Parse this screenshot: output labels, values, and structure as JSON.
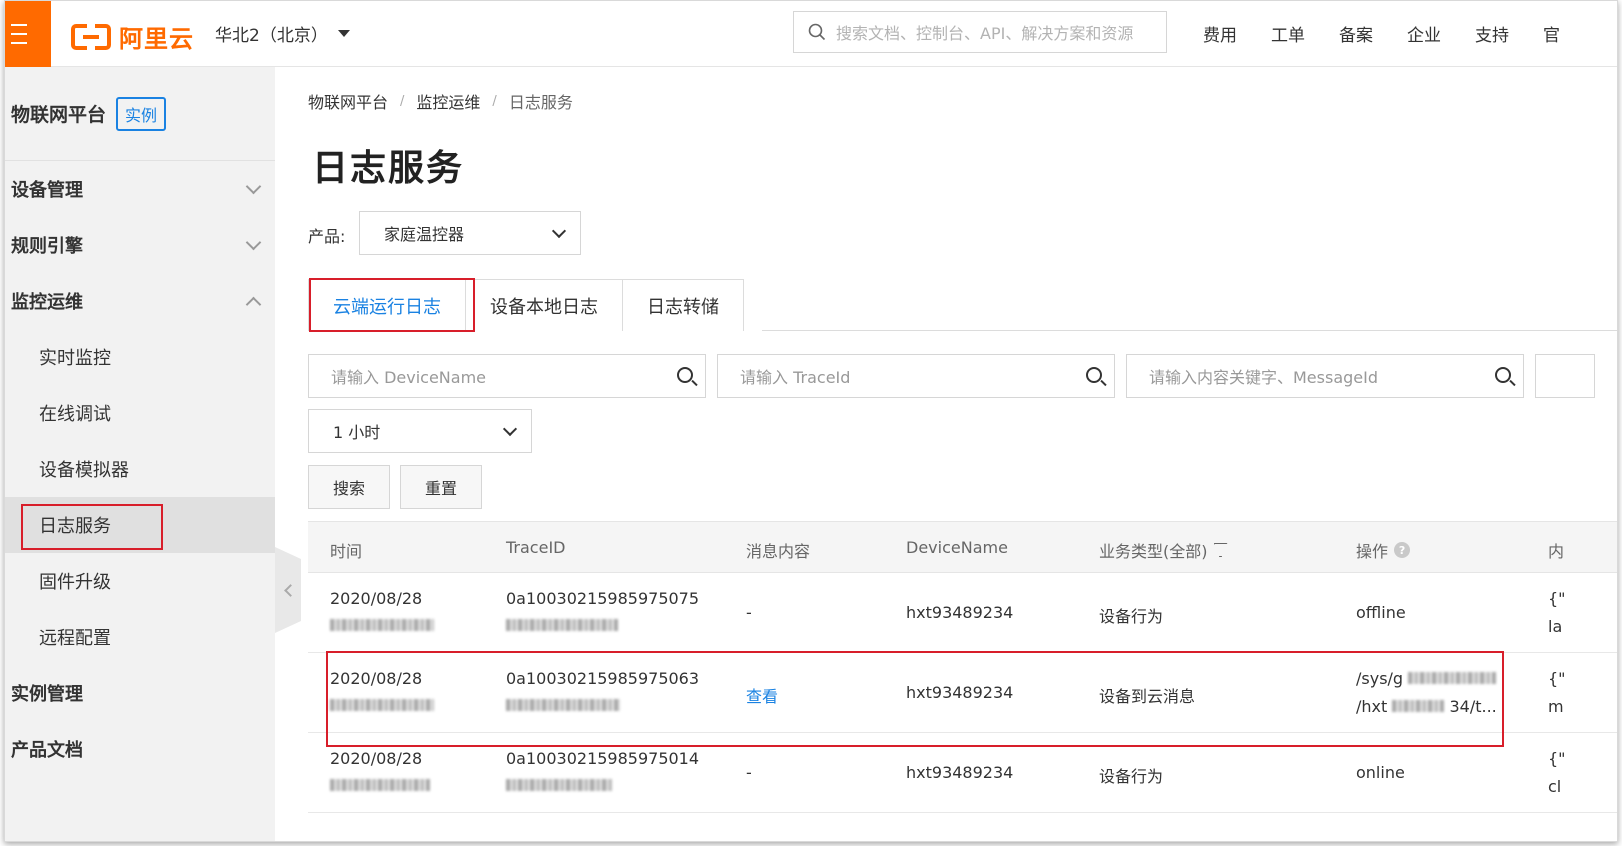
{
  "topbar": {
    "brand": "阿里云",
    "region": "华北2（北京）",
    "search_placeholder": "搜索文档、控制台、API、解决方案和资源",
    "nav": [
      "费用",
      "工单",
      "备案",
      "企业",
      "支持",
      "官"
    ]
  },
  "sidebar": {
    "title": "物联网平台",
    "badge": "实例",
    "items": [
      {
        "label": "设备管理"
      },
      {
        "label": "规则引擎"
      },
      {
        "label": "监控运维"
      },
      {
        "label": "实时监控"
      },
      {
        "label": "在线调试"
      },
      {
        "label": "设备模拟器"
      },
      {
        "label": "日志服务"
      },
      {
        "label": "固件升级"
      },
      {
        "label": "远程配置"
      },
      {
        "label": "实例管理"
      },
      {
        "label": "产品文档"
      }
    ]
  },
  "breadcrumb": [
    "物联网平台",
    "监控运维",
    "日志服务"
  ],
  "breadcrumb_sep": "/",
  "page_title": "日志服务",
  "product": {
    "label": "产品:",
    "value": "家庭温控器"
  },
  "tabs": [
    "云端运行日志",
    "设备本地日志",
    "日志转储"
  ],
  "filters": {
    "device_placeholder": "请输入 DeviceName",
    "trace_placeholder": "请输入 TraceId",
    "content_placeholder": "请输入内容关键字、MessageId",
    "time_range": "1 小时",
    "search_button": "搜索",
    "reset_button": "重置"
  },
  "table": {
    "headers": [
      "时间",
      "TraceID",
      "消息内容",
      "DeviceName",
      "业务类型(全部)",
      "操作",
      "内"
    ],
    "rows": [
      {
        "date": "2020/08/28",
        "trace": "0a10030215985975075",
        "msg": "-",
        "device": "hxt93489234",
        "type": "设备行为",
        "op1": "offline",
        "op2": "",
        "extra1": "{\"",
        "extra2": "la"
      },
      {
        "date": "2020/08/28",
        "trace": "0a10030215985975063",
        "msg": "查看",
        "device": "hxt93489234",
        "type": "设备到云消息",
        "op1": "/sys/g",
        "op2": "/hxt",
        "op2_tail": "34/t...",
        "extra1": "{\"",
        "extra2": "m"
      },
      {
        "date": "2020/08/28",
        "trace": "0a10030215985975014",
        "msg": "-",
        "device": "hxt93489234",
        "type": "设备行为",
        "op1": "online",
        "op2": "",
        "extra1": "{\"",
        "extra2": "cl"
      }
    ]
  },
  "colors": {
    "brand": "#ff6a00",
    "accent": "#1a82e2",
    "highlight": "#d81e2a"
  }
}
